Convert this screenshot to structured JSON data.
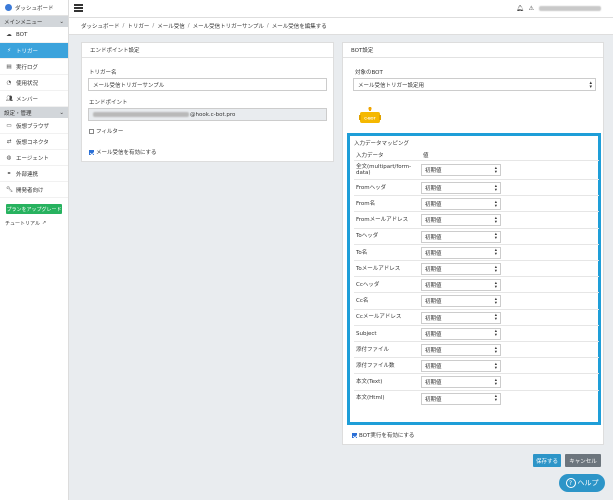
{
  "sidebar": {
    "app_title": "ダッシュボード",
    "section_main": "メインメニュー",
    "items_main": [
      {
        "label": "BOT",
        "icon": "cloud-icon"
      },
      {
        "label": "トリガー",
        "icon": "bolt-icon",
        "active": true
      },
      {
        "label": "実行ログ",
        "icon": "file-icon"
      },
      {
        "label": "使用状況",
        "icon": "pie-chart-icon"
      },
      {
        "label": "メンバー",
        "icon": "users-icon"
      }
    ],
    "section_settings": "設定・管理",
    "items_settings": [
      {
        "label": "仮想ブラウザ",
        "icon": "browser-icon"
      },
      {
        "label": "仮想コネクタ",
        "icon": "connector-icon"
      },
      {
        "label": "エージェント",
        "icon": "agent-icon"
      },
      {
        "label": "外部連携",
        "icon": "link-icon"
      },
      {
        "label": "開発者向け",
        "icon": "wrench-icon"
      }
    ],
    "upgrade_label": "プランをアップグレード",
    "tutorial_label": "チュートリアル"
  },
  "breadcrumb": [
    "ダッシュボード",
    "トリガー",
    "メール受信",
    "メール受信トリガーサンプル",
    "メール受信を編集する"
  ],
  "endpoint_card": {
    "header": "エンドポイント設定",
    "trigger_name_label": "トリガー名",
    "trigger_name_value": "メール受信トリガーサンプル",
    "endpoint_label": "エンドポイント",
    "endpoint_suffix": "@hook.c-bot.pro",
    "filter_label": "フィルター",
    "enable_mail_label": "メール受信を有効にする"
  },
  "bot_card": {
    "header": "BOT設定",
    "target_label": "対象のBOT",
    "target_value": "メール受信トリガー設定用",
    "robot_text": "C-BOT",
    "mapping_title": "入力データマッピング",
    "col_input": "入力データ",
    "col_value": "値",
    "rows": [
      {
        "key": "全文(multipart/form-data)",
        "value": "初期値"
      },
      {
        "key": "Fromヘッダ",
        "value": "初期値"
      },
      {
        "key": "From名",
        "value": "初期値"
      },
      {
        "key": "Fromメールアドレス",
        "value": "初期値"
      },
      {
        "key": "Toヘッダ",
        "value": "初期値"
      },
      {
        "key": "To名",
        "value": "初期値"
      },
      {
        "key": "Toメールアドレス",
        "value": "初期値"
      },
      {
        "key": "Ccヘッダ",
        "value": "初期値"
      },
      {
        "key": "Cc名",
        "value": "初期値"
      },
      {
        "key": "Ccメールアドレス",
        "value": "初期値"
      },
      {
        "key": "Subject",
        "value": "初期値"
      },
      {
        "key": "添付ファイル",
        "value": "初期値"
      },
      {
        "key": "添付ファイル数",
        "value": "初期値"
      },
      {
        "key": "本文(Text)",
        "value": "初期値"
      },
      {
        "key": "本文(Html)",
        "value": "初期値"
      }
    ],
    "enable_bot_label": "BOT実行を有効にする"
  },
  "buttons": {
    "save": "保存する",
    "cancel": "キャンセル",
    "help": "ヘルプ"
  },
  "colors": {
    "accent": "#3ca3dc",
    "highlight": "#1e9ed8",
    "green": "#27b25f",
    "cancel": "#6c757d"
  }
}
